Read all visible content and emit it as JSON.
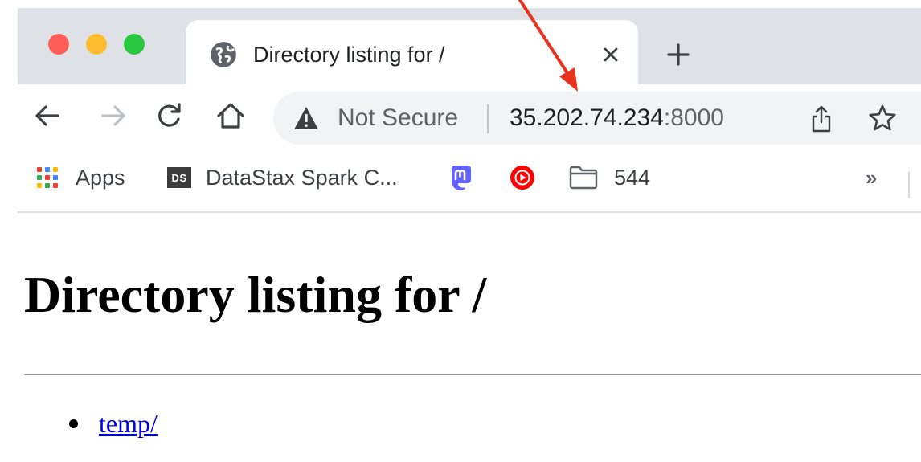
{
  "tab": {
    "title": "Directory listing for /",
    "close_icon": "close-icon",
    "new_tab_icon": "plus-icon"
  },
  "toolbar": {
    "icons": [
      "back-arrow-icon",
      "forward-arrow-icon",
      "reload-icon",
      "home-icon"
    ]
  },
  "omnibox": {
    "security_label": "Not Secure",
    "url_host": "35.202.74.234",
    "url_port": ":8000",
    "icons": [
      "warning-icon",
      "share-icon",
      "star-icon"
    ]
  },
  "bookmarks": {
    "apps_label": "Apps",
    "datastax_badge": "DS",
    "datastax_label": "DataStax Spark C...",
    "folder_label": "544",
    "more_label": "»"
  },
  "page": {
    "heading": "Directory listing for /",
    "entries": [
      {
        "label": "temp/"
      }
    ]
  },
  "colors": {
    "tabstrip": "#dee1e6",
    "omnibox": "#f1f3f4",
    "link": "#0000ee",
    "annotation": "#e8331f"
  }
}
